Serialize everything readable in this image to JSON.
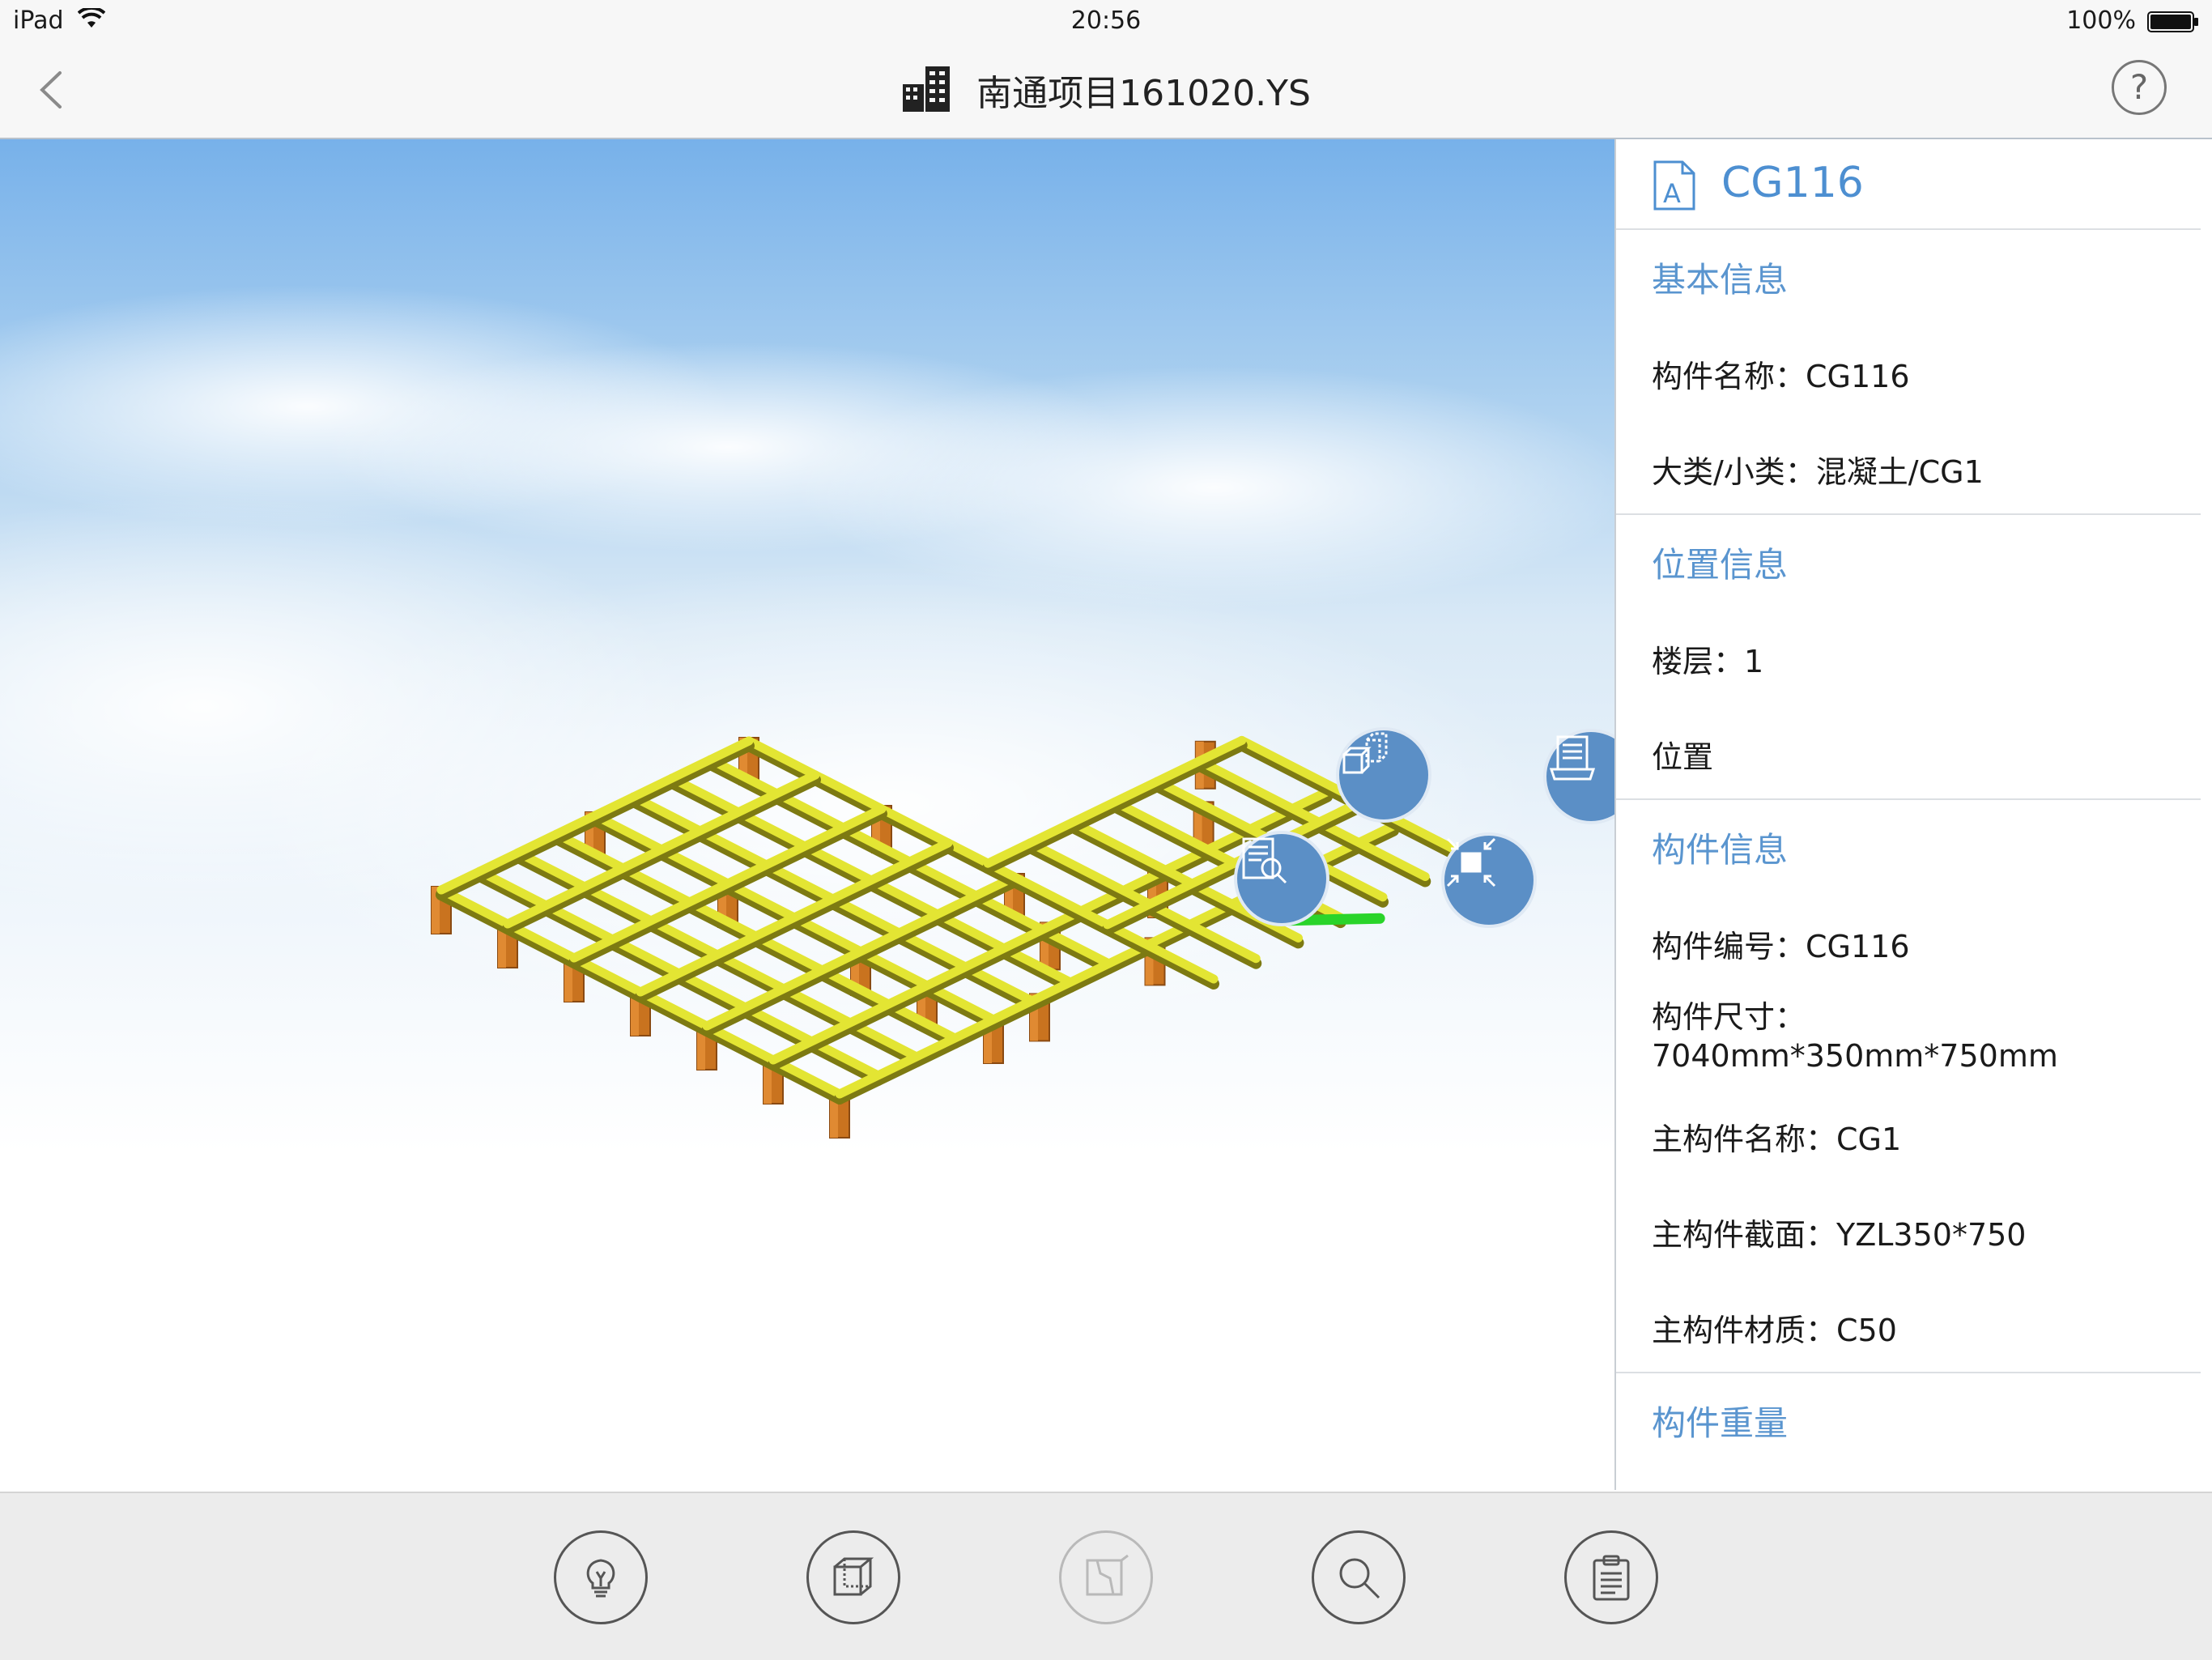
{
  "status_bar": {
    "device": "iPad",
    "time": "20:56",
    "battery": "100%"
  },
  "nav": {
    "title": "南通项目161020.YS",
    "help": "?"
  },
  "panel": {
    "component_id": "CG116",
    "sections": [
      {
        "title": "基本信息",
        "rows": [
          "构件名称：CG116",
          "大类/小类：混凝土/CG1"
        ]
      },
      {
        "title": "位置信息",
        "rows": [
          "楼层：1",
          "位置"
        ]
      },
      {
        "title": "构件信息",
        "rows": [
          "构件编号：CG116",
          "构件尺寸：7040mm*350mm*750mm",
          "主构件名称：CG1",
          "主构件截面：YZL350*750",
          "主构件材质：C50"
        ]
      },
      {
        "title": "构件重量",
        "rows": []
      }
    ]
  },
  "viewport": {
    "model": "3d-beam-column-grid",
    "colors": {
      "beam": "#e3e533",
      "column": "#c9731f",
      "selected_beam": "#2ad42a"
    },
    "floating_actions": [
      "isolate-component-icon",
      "drawing-doc-icon",
      "document-search-icon",
      "fit-to-view-icon"
    ]
  },
  "toolbar": {
    "buttons": [
      "lightbulb-icon",
      "cube-view-icon",
      "section-plane-icon",
      "search-icon",
      "clipboard-icon"
    ]
  },
  "colors": {
    "accent": "#4d8fd1",
    "section_title": "#5a95cf",
    "fab": "#5b8fc6"
  }
}
